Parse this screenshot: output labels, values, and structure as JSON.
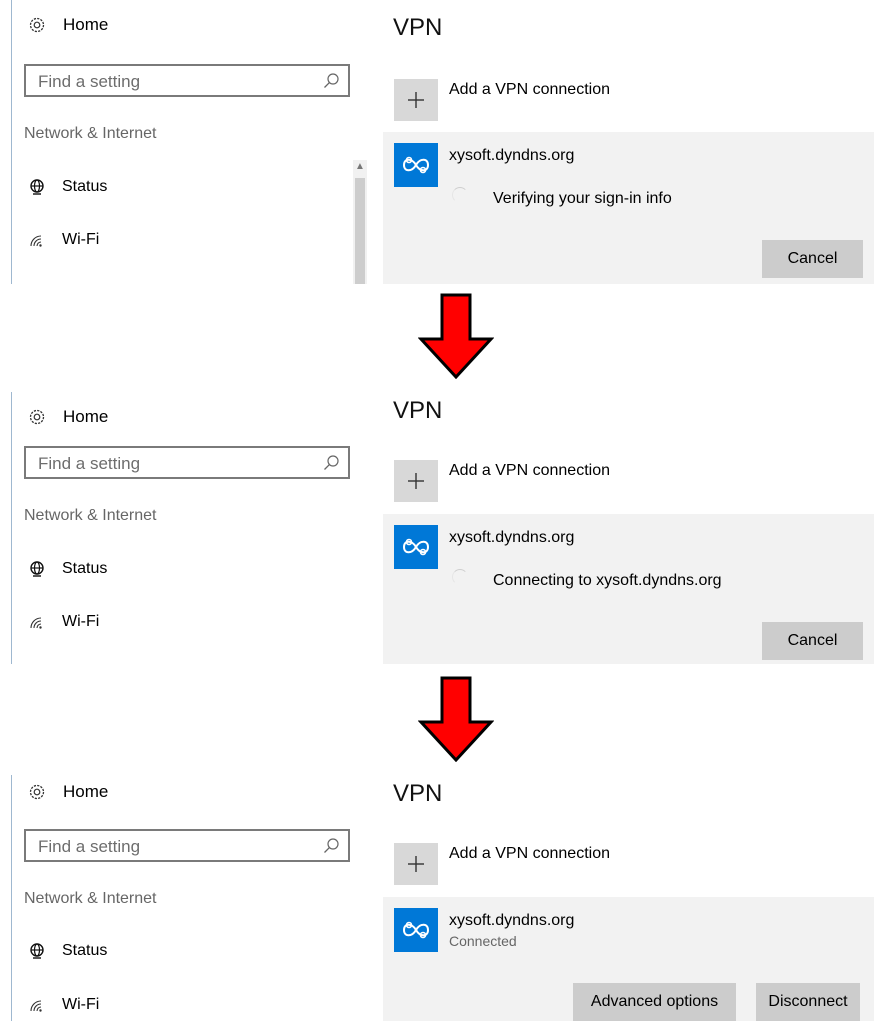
{
  "colors": {
    "accent": "#0078d7",
    "arrow": "#ff0000",
    "card_bg": "#f2f2f2",
    "button_bg": "#cccccc"
  },
  "icons": [
    "gear-icon",
    "search-icon",
    "globe-icon",
    "wifi-icon",
    "plus-icon",
    "vpn-icon",
    "down-arrow"
  ],
  "panels": [
    {
      "sidebar": {
        "home": "Home",
        "search_placeholder": "Find a setting",
        "section": "Network & Internet",
        "status": "Status",
        "wifi": "Wi-Fi"
      },
      "main": {
        "title": "VPN",
        "add_label": "Add a VPN connection",
        "vpn_name": "xysoft.dyndns.org",
        "status_text": "Verifying your sign-in info",
        "cancel": "Cancel"
      }
    },
    {
      "sidebar": {
        "home": "Home",
        "search_placeholder": "Find a setting",
        "section": "Network & Internet",
        "status": "Status",
        "wifi": "Wi-Fi"
      },
      "main": {
        "title": "VPN",
        "add_label": "Add a VPN connection",
        "vpn_name": "xysoft.dyndns.org",
        "status_text": "Connecting to xysoft.dyndns.org",
        "cancel": "Cancel"
      }
    },
    {
      "sidebar": {
        "home": "Home",
        "search_placeholder": "Find a setting",
        "section": "Network & Internet",
        "status": "Status",
        "wifi": "Wi-Fi"
      },
      "main": {
        "title": "VPN",
        "add_label": "Add a VPN connection",
        "vpn_name": "xysoft.dyndns.org",
        "connected_text": "Connected",
        "advanced": "Advanced options",
        "disconnect": "Disconnect"
      }
    }
  ]
}
